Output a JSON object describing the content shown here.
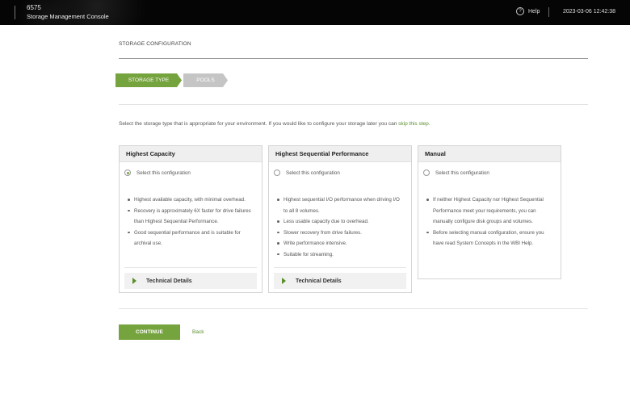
{
  "header": {
    "code": "6575",
    "app_name": "Storage Management Console",
    "help_label": "Help",
    "help_icon": "question-circle-icon",
    "datetime": "2023-03-06 12:42:38"
  },
  "page": {
    "title": "STORAGE CONFIGURATION",
    "steps": [
      {
        "label": "STORAGE TYPE",
        "active": true
      },
      {
        "label": "POOLS",
        "active": false
      }
    ],
    "intro_text": "Select the storage type that is appropriate for your environment. If you would like to configure your storage later you can",
    "intro_link": "skip this step."
  },
  "cards": [
    {
      "title": "Highest Capacity",
      "radio_label": "Select this configuration",
      "selected": true,
      "bullets": [
        "Highest available capacity, with minimal overhead.",
        "Recovery is approximately 6X faster for drive failures than Highest Sequential Performance.",
        "Good sequential performance and is suitable for archival use."
      ],
      "details_label": "Technical Details"
    },
    {
      "title": "Highest Sequential Performance",
      "radio_label": "Select this configuration",
      "selected": false,
      "bullets": [
        "Highest sequential I/O performance when driving I/O to all 8 volumes.",
        "Less usable capacity due to overhead.",
        "Slower recovery from drive failures.",
        "Write performance intensive.",
        "Suitable for streaming."
      ],
      "details_label": "Technical Details"
    },
    {
      "title": "Manual",
      "radio_label": "Select this configuration",
      "selected": false,
      "bullets": [
        "If neither Highest Capacity nor Highest Sequential Performance meet your requirements, you can manually configure disk groups and volumes.",
        "Before selecting manual configuration, ensure you have read System Concepts in the WBI Help."
      ]
    }
  ],
  "footer": {
    "continue_label": "CONTINUE",
    "back_label": "Back"
  },
  "colors": {
    "accent": "#75a33e",
    "link": "#5a8f2c",
    "topbar": "#050505"
  }
}
